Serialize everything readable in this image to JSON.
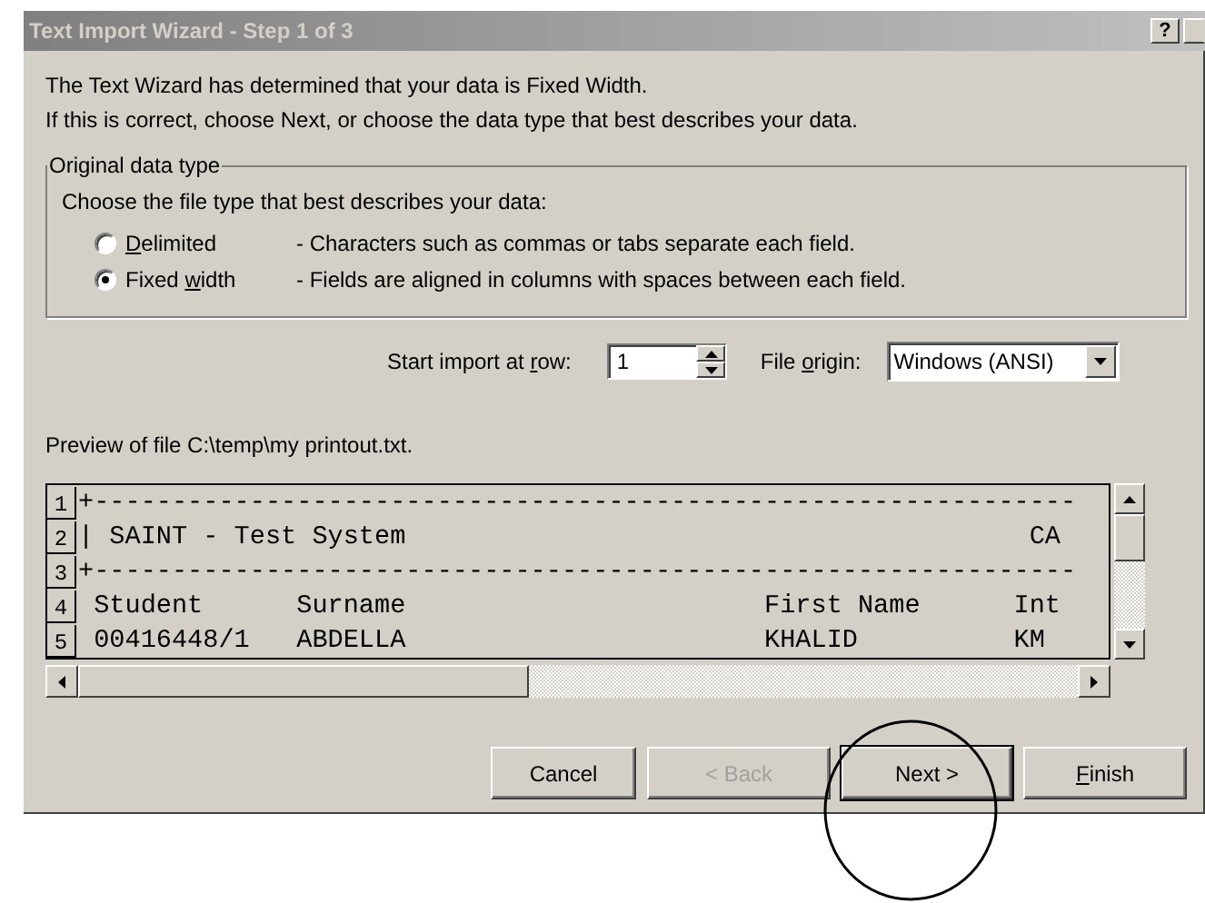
{
  "window": {
    "title": "Text Import Wizard - Step 1 of 3",
    "help": "?"
  },
  "intro": [
    "The Text Wizard has determined that your data is Fixed Width.",
    "If this is correct, choose Next, or choose the data type that best describes your data."
  ],
  "data_type": {
    "legend": "Original data type",
    "prompt": "Choose the file type that best describes your data:",
    "options": [
      {
        "access_key": "D",
        "label_post": "elimited",
        "description": "- Characters such as commas or tabs separate each field.",
        "selected": false
      },
      {
        "label_pre": "Fixed ",
        "access_key": "w",
        "label_post": "idth",
        "description": "- Fields are aligned in columns with spaces between each field.",
        "selected": true
      }
    ]
  },
  "start_row": {
    "label_pre": "Start import at ",
    "access_key": "r",
    "label_post": "ow:",
    "value": "1"
  },
  "file_origin": {
    "label_pre": "File ",
    "access_key": "o",
    "label_post": "rigin:",
    "value": "Windows (ANSI)"
  },
  "preview": {
    "label": "Preview of file C:\\temp\\my printout.txt.",
    "rows": [
      {
        "number": "1",
        "text": "+---------------------------------------------------------------"
      },
      {
        "number": "2",
        "text": "| SAINT - Test System                                        CA"
      },
      {
        "number": "3",
        "text": "+---------------------------------------------------------------"
      },
      {
        "number": "4",
        "text": " Student      Surname                       First Name      Int"
      },
      {
        "number": "5",
        "text": " 00416448/1   ABDELLA                       KHALID          KM"
      }
    ]
  },
  "buttons": [
    {
      "label_pre": "Cancel",
      "disabled": false,
      "default": false
    },
    {
      "label_pre": "< Back",
      "disabled": true,
      "default": false
    },
    {
      "label_pre": "Next >",
      "disabled": false,
      "default": true
    },
    {
      "access_key": "F",
      "label_post": "inish",
      "disabled": false,
      "default": false
    }
  ],
  "annotation": {
    "kind": "circle"
  }
}
